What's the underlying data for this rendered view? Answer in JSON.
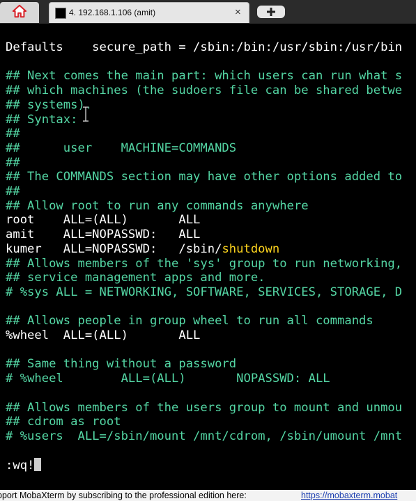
{
  "tabs": {
    "home_icon": "home-icon",
    "active_tab_label": "4. 192.168.1.106 (amit)",
    "active_tab_icon": "terminal-icon",
    "close_glyph": "×",
    "new_tab_icon": "plus-icon"
  },
  "terminal": {
    "lines": [
      {
        "segments": [
          {
            "t": "Defaults    secure_path = /sbin:/bin:/usr/sbin:/usr/bin",
            "c": "w"
          }
        ]
      },
      {
        "segments": []
      },
      {
        "segments": [
          {
            "t": "## Next comes the main part: which users can run what s",
            "c": "g"
          }
        ]
      },
      {
        "segments": [
          {
            "t": "## which machines (the sudoers file can be shared betwe",
            "c": "g"
          }
        ]
      },
      {
        "segments": [
          {
            "t": "## systems).",
            "c": "g"
          }
        ]
      },
      {
        "segments": [
          {
            "t": "## Syntax:",
            "c": "g"
          }
        ]
      },
      {
        "segments": [
          {
            "t": "##",
            "c": "g"
          }
        ]
      },
      {
        "segments": [
          {
            "t": "##      user    MACHINE=COMMANDS",
            "c": "g"
          }
        ]
      },
      {
        "segments": [
          {
            "t": "##",
            "c": "g"
          }
        ]
      },
      {
        "segments": [
          {
            "t": "## The COMMANDS section may have other options added to",
            "c": "g"
          }
        ]
      },
      {
        "segments": [
          {
            "t": "##",
            "c": "g"
          }
        ]
      },
      {
        "segments": [
          {
            "t": "## Allow root to run any commands anywhere",
            "c": "g"
          }
        ]
      },
      {
        "segments": [
          {
            "t": "root    ALL=(ALL)       ALL",
            "c": "w"
          }
        ]
      },
      {
        "segments": [
          {
            "t": "amit    ALL=NOPASSWD:   ALL",
            "c": "w"
          }
        ]
      },
      {
        "segments": [
          {
            "t": "kumer   ALL=NOPASSWD:   /sbin/",
            "c": "w"
          },
          {
            "t": "shutdown",
            "c": "y"
          }
        ]
      },
      {
        "segments": [
          {
            "t": "## Allows members of the 'sys' group to run networking,",
            "c": "g"
          }
        ]
      },
      {
        "segments": [
          {
            "t": "## service management apps and more.",
            "c": "g"
          }
        ]
      },
      {
        "segments": [
          {
            "t": "# %sys ALL = NETWORKING, SOFTWARE, SERVICES, STORAGE, D",
            "c": "g"
          }
        ]
      },
      {
        "segments": []
      },
      {
        "segments": [
          {
            "t": "## Allows people in group wheel to run all commands",
            "c": "g"
          }
        ]
      },
      {
        "segments": [
          {
            "t": "%wheel  ALL=(ALL)       ALL",
            "c": "w"
          }
        ]
      },
      {
        "segments": []
      },
      {
        "segments": [
          {
            "t": "## Same thing without a password",
            "c": "g"
          }
        ]
      },
      {
        "segments": [
          {
            "t": "# %wheel        ALL=(ALL)       NOPASSWD: ALL",
            "c": "g"
          }
        ]
      },
      {
        "segments": []
      },
      {
        "segments": [
          {
            "t": "## Allows members of the users group to mount and unmou",
            "c": "g"
          }
        ]
      },
      {
        "segments": [
          {
            "t": "## cdrom as root",
            "c": "g"
          }
        ]
      },
      {
        "segments": [
          {
            "t": "# %users  ALL=/sbin/mount /mnt/cdrom, /sbin/umount /mnt",
            "c": "g"
          }
        ]
      },
      {
        "segments": []
      },
      {
        "segments": [
          {
            "t": ":wq!",
            "c": "w"
          }
        ],
        "cursor": true
      }
    ],
    "mouse_cursor_icon": "text-cursor-icon"
  },
  "status_bar": {
    "message": "pport MobaXterm by subscribing to the professional edition here:",
    "link": "https://mobaxterm.mobat"
  },
  "colors": {
    "comment_green": "#54d6a4",
    "text_white": "#ffffff",
    "highlight_yellow": "#ffd51e",
    "background": "#000000"
  }
}
